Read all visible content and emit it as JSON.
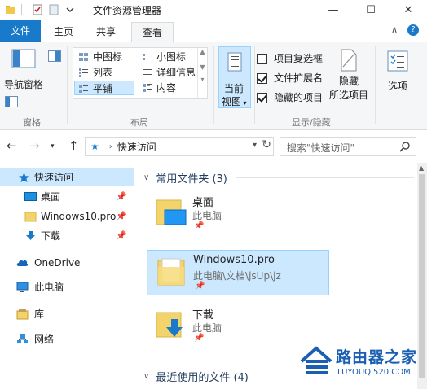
{
  "window": {
    "title": "文件资源管理器",
    "controls": [
      "—",
      "☐",
      "✕"
    ]
  },
  "tabs": {
    "file": "文件",
    "home": "主页",
    "share": "共享",
    "view": "查看"
  },
  "ribbon": {
    "panes": {
      "nav_pane_label_line1": "导航窗格",
      "group_label": "窗格"
    },
    "layout": {
      "items": [
        "中图标",
        "小图标",
        "列表",
        "详细信息",
        "平铺",
        "内容"
      ],
      "selected": "平铺",
      "group_label": "布局"
    },
    "current_view": {
      "line1": "当前",
      "line2": "视图",
      "group_label": ""
    },
    "show_hide": {
      "checkboxes": [
        {
          "label": "项目复选框",
          "checked": false
        },
        {
          "label": "文件扩展名",
          "checked": true
        },
        {
          "label": "隐藏的项目",
          "checked": true
        }
      ],
      "hide_selected_line1": "隐藏",
      "hide_selected_line2": "所选项目",
      "group_label": "显示/隐藏"
    },
    "options": "选项"
  },
  "address": {
    "location": "快速访问",
    "search_placeholder": "搜索\"快速访问\""
  },
  "navpane": {
    "items": [
      {
        "label": "快速访问",
        "icon": "star-icon",
        "pinned": false
      },
      {
        "label": "桌面",
        "icon": "desktop-icon",
        "pinned": true
      },
      {
        "label": "Windows10.pro",
        "icon": "folder-icon",
        "pinned": true
      },
      {
        "label": "下载",
        "icon": "download-icon",
        "pinned": true
      },
      {
        "label": "OneDrive",
        "icon": "cloud-icon",
        "pinned": false
      },
      {
        "label": "此电脑",
        "icon": "computer-icon",
        "pinned": false
      },
      {
        "label": "库",
        "icon": "library-icon",
        "pinned": false
      },
      {
        "label": "网络",
        "icon": "network-icon",
        "pinned": false
      }
    ]
  },
  "main": {
    "frequent": {
      "header": "常用文件夹 (3)",
      "folders": [
        {
          "name": "桌面",
          "path": "此电脑",
          "icon": "desktop-folder-icon"
        },
        {
          "name": "Windows10.pro",
          "path": "此电脑\\文档\\jsUp\\jz",
          "icon": "folder-icon"
        },
        {
          "name": "下载",
          "path": "此电脑",
          "icon": "download-folder-icon"
        }
      ]
    },
    "recent": {
      "header": "最近使用的文件 (4)"
    }
  },
  "watermark": {
    "text": "路由器之家",
    "url": "LUYOUQI520.COM"
  },
  "colors": {
    "accent": "#1979ca",
    "selection": "#cce8ff",
    "selection_border": "#99d1ff"
  }
}
